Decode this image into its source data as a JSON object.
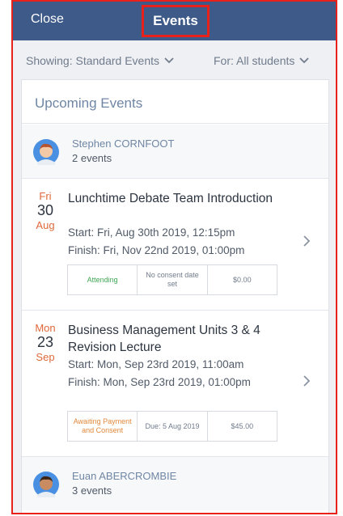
{
  "topbar": {
    "close_label": "Close",
    "title": "Events"
  },
  "filters": {
    "showing": "Showing: Standard Events",
    "for": "For: All students"
  },
  "section_title": "Upcoming Events",
  "people": [
    {
      "name": "Stephen CORNFOOT",
      "count": "2 events"
    },
    {
      "name": "Euan ABERCROMBIE",
      "count": "3 events"
    }
  ],
  "events": [
    {
      "dow": "Fri",
      "day": "30",
      "mon": "Aug",
      "title": "Lunchtime Debate Team Introduction",
      "start": "Start:  Fri, Aug 30th 2019, 12:15pm",
      "finish": "Finish:  Fri, Nov 22nd 2019, 01:00pm",
      "status": "Attending",
      "consent": "No consent date set",
      "price": "$0.00"
    },
    {
      "dow": "Mon",
      "day": "23",
      "mon": "Sep",
      "title": "Business Management Units 3 & 4 Revision Lecture",
      "start": "Start:  Mon, Sep 23rd 2019, 11:00am",
      "finish": "Finish:  Mon, Sep 23rd 2019, 01:00pm",
      "status": "Awaiting Payment and Consent",
      "due": "Due: 5 Aug 2019",
      "price": "$45.00"
    }
  ],
  "colors": {
    "topbar": "#3d5a89",
    "highlight_border": "#e8221b",
    "date_accent": "#e0683b",
    "attending": "#3fa653",
    "awaiting": "#e0883b"
  }
}
